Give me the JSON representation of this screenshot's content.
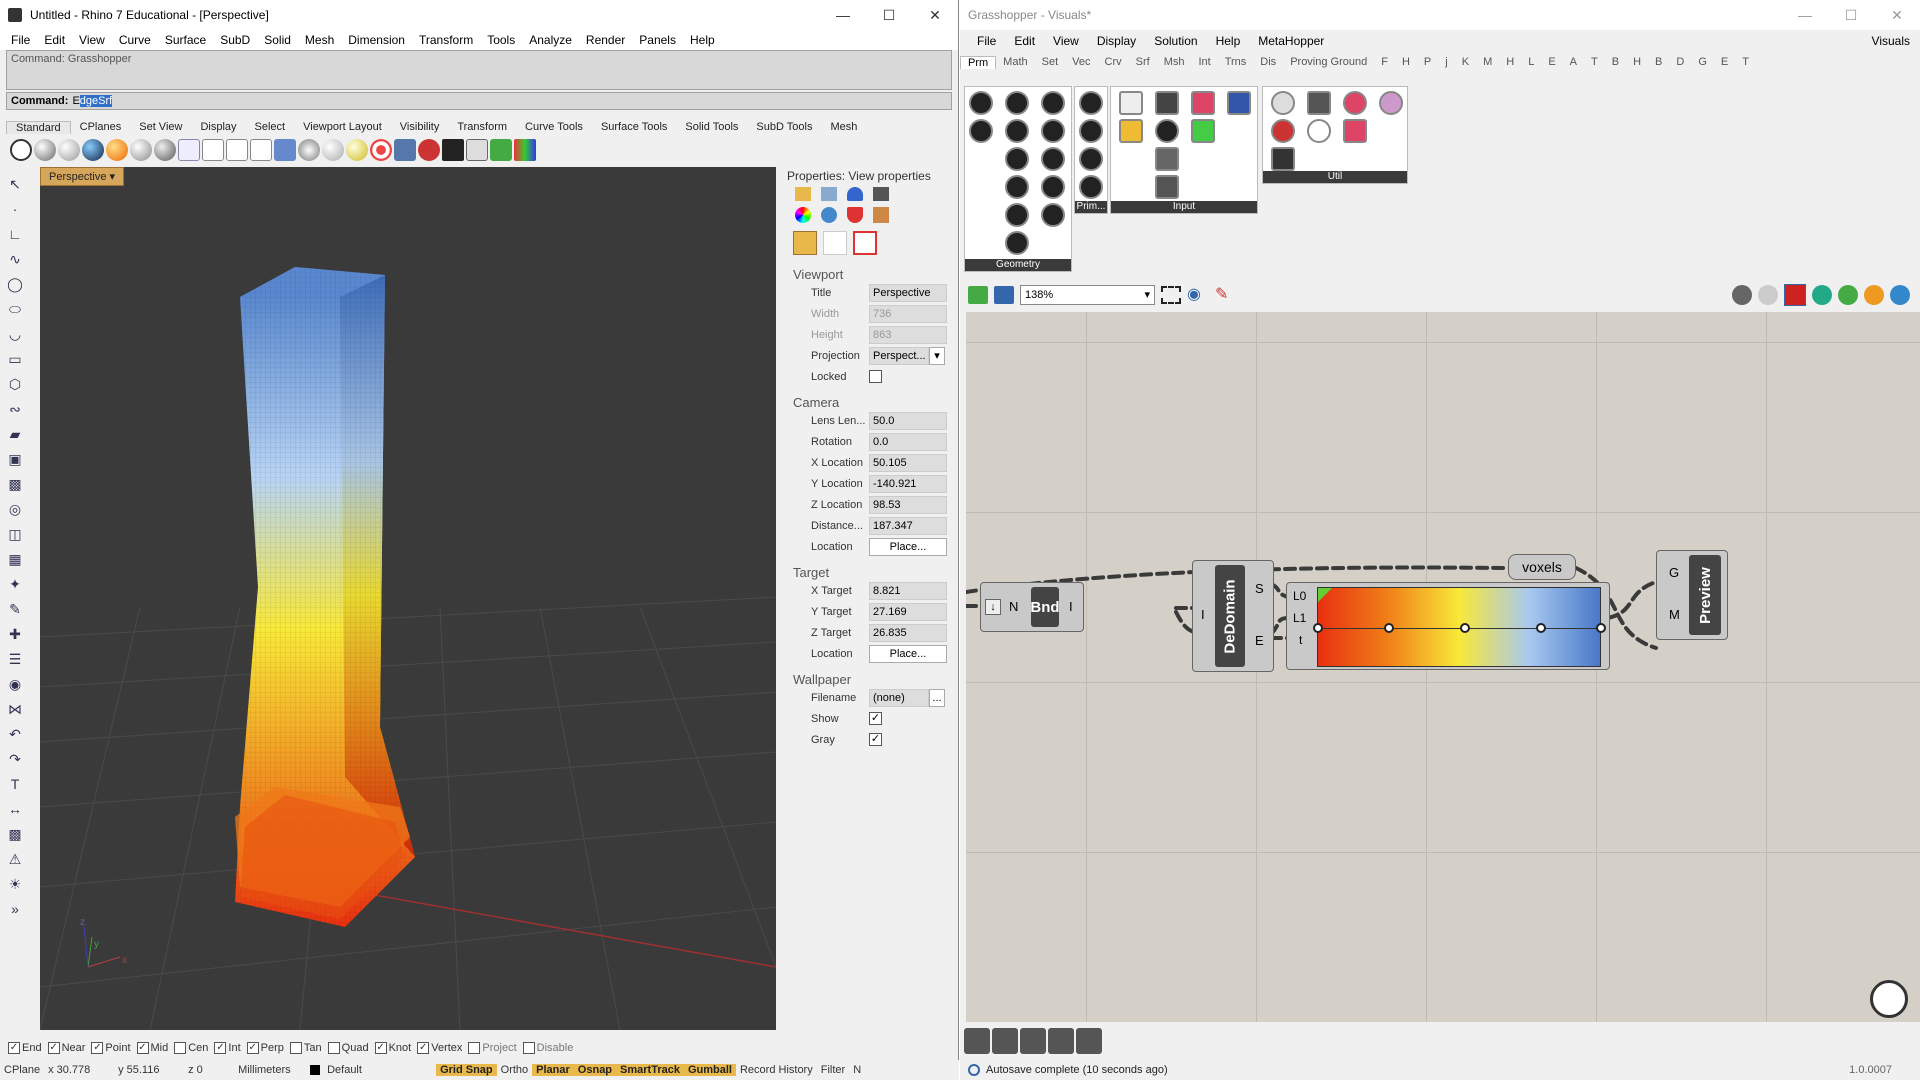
{
  "rhino": {
    "title": "Untitled - Rhino 7 Educational - [Perspective]",
    "menu": [
      "File",
      "Edit",
      "View",
      "Curve",
      "Surface",
      "SubD",
      "Solid",
      "Mesh",
      "Dimension",
      "Transform",
      "Tools",
      "Analyze",
      "Render",
      "Panels",
      "Help"
    ],
    "command_history": "Command: Grasshopper",
    "command_label": "Command:",
    "command_value_pre": "E",
    "command_value_sel": "dgeSrf",
    "toolbar_tabs": [
      "Standard",
      "CPlanes",
      "Set View",
      "Display",
      "Select",
      "Viewport Layout",
      "Visibility",
      "Transform",
      "Curve Tools",
      "Surface Tools",
      "Solid Tools",
      "SubD Tools",
      "Mesh"
    ],
    "viewport_label": "Perspective",
    "axis_x": "x",
    "axis_y": "y",
    "axis_z": "z",
    "properties": {
      "title": "Properties: View properties",
      "viewport_section": "Viewport",
      "viewport": [
        {
          "label": "Title",
          "value": "Perspective",
          "dim": false
        },
        {
          "label": "Width",
          "value": "736",
          "dim": true
        },
        {
          "label": "Height",
          "value": "863",
          "dim": true
        },
        {
          "label": "Projection",
          "value": "Perspect...",
          "dim": false
        }
      ],
      "locked_label": "Locked",
      "camera_section": "Camera",
      "camera": [
        {
          "label": "Lens Len...",
          "value": "50.0"
        },
        {
          "label": "Rotation",
          "value": "0.0"
        },
        {
          "label": "X Location",
          "value": "50.105"
        },
        {
          "label": "Y Location",
          "value": "-140.921"
        },
        {
          "label": "Z Location",
          "value": "98.53"
        },
        {
          "label": "Distance...",
          "value": "187.347"
        }
      ],
      "location_label": "Location",
      "place_label": "Place...",
      "target_section": "Target",
      "target": [
        {
          "label": "X Target",
          "value": "8.821"
        },
        {
          "label": "Y Target",
          "value": "27.169"
        },
        {
          "label": "Z Target",
          "value": "26.835"
        }
      ],
      "wallpaper_section": "Wallpaper",
      "filename_label": "Filename",
      "filename_value": "(none)",
      "filename_btn": "...",
      "show_label": "Show",
      "gray_label": "Gray"
    },
    "osnaps": [
      {
        "label": "End",
        "checked": true
      },
      {
        "label": "Near",
        "checked": true
      },
      {
        "label": "Point",
        "checked": true
      },
      {
        "label": "Mid",
        "checked": true
      },
      {
        "label": "Cen",
        "checked": false
      },
      {
        "label": "Int",
        "checked": true
      },
      {
        "label": "Perp",
        "checked": true
      },
      {
        "label": "Tan",
        "checked": false
      },
      {
        "label": "Quad",
        "checked": false
      },
      {
        "label": "Knot",
        "checked": true
      },
      {
        "label": "Vertex",
        "checked": true
      },
      {
        "label": "Project",
        "checked": false
      },
      {
        "label": "Disable",
        "checked": false
      }
    ],
    "status": {
      "cplane": "CPlane",
      "x": "x 30.778",
      "y": "y 55.116",
      "z": "z 0",
      "units": "Millimeters",
      "layer": "Default",
      "grid_snap": "Grid Snap",
      "ortho": "Ortho",
      "planar": "Planar",
      "osnap": "Osnap",
      "smarttrack": "SmartTrack",
      "gumball": "Gumball",
      "record_history": "Record History",
      "filter": "Filter",
      "more": "N"
    }
  },
  "gh": {
    "title": "Grasshopper - Visuals*",
    "menu": [
      "File",
      "Edit",
      "View",
      "Display",
      "Solution",
      "Help",
      "MetaHopper"
    ],
    "doc_name": "Visuals",
    "tabs": [
      "Prm",
      "Math",
      "Set",
      "Vec",
      "Crv",
      "Srf",
      "Msh",
      "Int",
      "Trns",
      "Dis",
      "Proving Ground",
      "F",
      "H",
      "P",
      "j",
      "K",
      "M",
      "H",
      "L",
      "E",
      "A",
      "T",
      "B",
      "H",
      "B",
      "D",
      "G",
      "E",
      "T"
    ],
    "panel_geometry": "Geometry",
    "panel_prim": "Prim...",
    "panel_input": "Input",
    "panel_util": "Util",
    "zoom": "138%",
    "nodes": {
      "voxels": "voxels",
      "bnd": "Bnd",
      "bnd_in": "N",
      "bnd_out": "I",
      "dedomain": "DeDomain",
      "dedomain_in": "I",
      "dedomain_s": "S",
      "dedomain_e": "E",
      "grad_l0": "L0",
      "grad_l1": "L1",
      "grad_t": "t",
      "preview": "Preview",
      "preview_g": "G",
      "preview_m": "M"
    },
    "gradient_colors": [
      "#e83010",
      "#f08018",
      "#f8e838",
      "#a8c8f0",
      "#4878c8"
    ],
    "status": "Autosave complete (10 seconds ago)",
    "version": "1.0.0007"
  }
}
